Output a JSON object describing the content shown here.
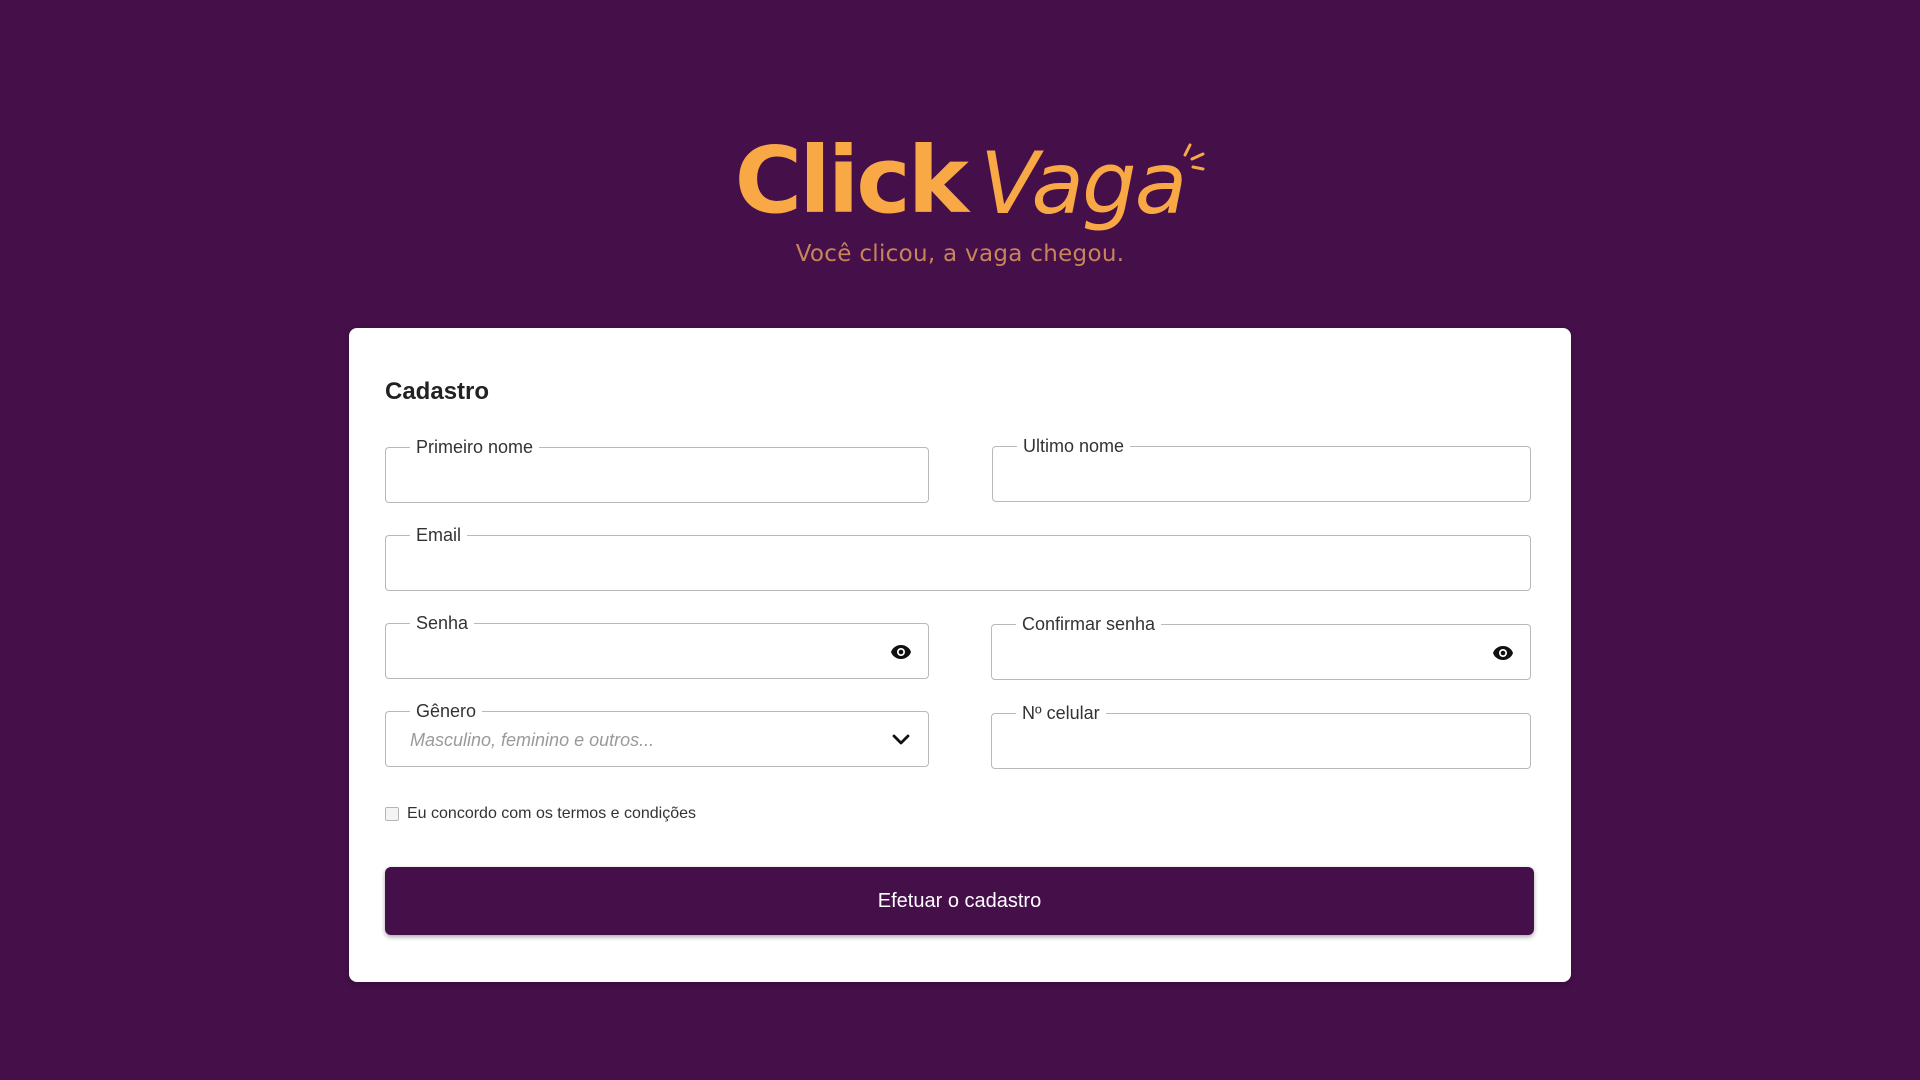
{
  "brand": {
    "name_part1": "Click",
    "name_part2": "Vaga",
    "tagline": "Você clicou, a vaga chegou.",
    "logo_color": "#f8a845",
    "tagline_color": "#c8855a"
  },
  "colors": {
    "background": "#450f4a",
    "card": "#ffffff",
    "primary_button": "#450f4a"
  },
  "form": {
    "title": "Cadastro",
    "fields": {
      "first_name": {
        "label": "Primeiro nome",
        "value": ""
      },
      "last_name": {
        "label": "Ultimo nome",
        "value": ""
      },
      "email": {
        "label": "Email",
        "value": ""
      },
      "password": {
        "label": "Senha",
        "value": "",
        "icon": "eye-icon"
      },
      "confirm_password": {
        "label": "Confirmar senha",
        "value": "",
        "icon": "eye-icon"
      },
      "gender": {
        "label": "Gênero",
        "placeholder": "Masculino, feminino e outros...",
        "icon": "chevron-down-icon"
      },
      "phone": {
        "label": "Nº celular",
        "value": ""
      }
    },
    "terms": {
      "label": "Eu concordo com os termos e condições",
      "checked": false
    },
    "submit_label": "Efetuar o cadastro"
  }
}
